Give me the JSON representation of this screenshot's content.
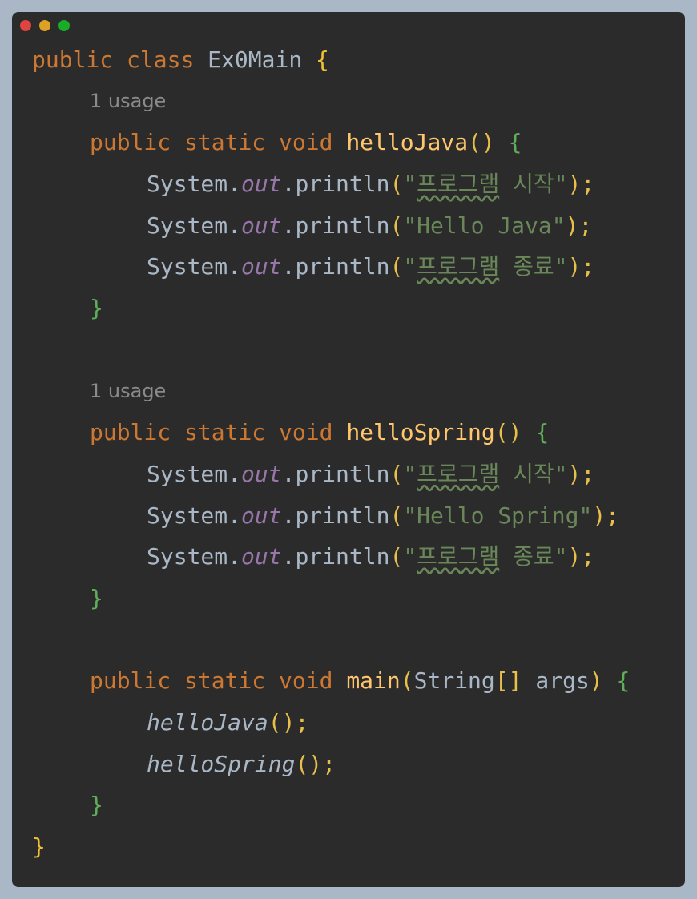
{
  "window_controls": [
    {
      "name": "close",
      "color": "#e0443e"
    },
    {
      "name": "minimize",
      "color": "#dea123"
    },
    {
      "name": "maximize",
      "color": "#1aab29"
    }
  ],
  "code": {
    "class_decl": {
      "kw1": "public",
      "kw2": "class",
      "name": "Ex0Main",
      "brace": "{"
    },
    "method1": {
      "usage": "1 usage",
      "kw1": "public",
      "kw2": "static",
      "kw3": "void",
      "name": "helloJava",
      "parens": "()",
      "brace": "{",
      "lines": [
        {
          "prefix": "System.",
          "field": "out",
          "call": ".println",
          "open": "(",
          "q1": "\"",
          "s_wavy": "프로그램",
          "s_rest": " 시작",
          "q2": "\"",
          "close": ");"
        },
        {
          "prefix": "System.",
          "field": "out",
          "call": ".println",
          "open": "(",
          "q1": "\"",
          "s_wavy": "",
          "s_rest": "Hello Java",
          "q2": "\"",
          "close": ");"
        },
        {
          "prefix": "System.",
          "field": "out",
          "call": ".println",
          "open": "(",
          "q1": "\"",
          "s_wavy": "프로그램",
          "s_rest": " 종료",
          "q2": "\"",
          "close": ");"
        }
      ],
      "end": "}"
    },
    "method2": {
      "usage": "1 usage",
      "kw1": "public",
      "kw2": "static",
      "kw3": "void",
      "name": "helloSpring",
      "parens": "()",
      "brace": "{",
      "lines": [
        {
          "prefix": "System.",
          "field": "out",
          "call": ".println",
          "open": "(",
          "q1": "\"",
          "s_wavy": "프로그램",
          "s_rest": " 시작",
          "q2": "\"",
          "close": ");"
        },
        {
          "prefix": "System.",
          "field": "out",
          "call": ".println",
          "open": "(",
          "q1": "\"",
          "s_wavy": "",
          "s_rest": "Hello Spring",
          "q2": "\"",
          "close": ");"
        },
        {
          "prefix": "System.",
          "field": "out",
          "call": ".println",
          "open": "(",
          "q1": "\"",
          "s_wavy": "프로그램",
          "s_rest": " 종료",
          "q2": "\"",
          "close": ");"
        }
      ],
      "end": "}"
    },
    "main": {
      "kw1": "public",
      "kw2": "static",
      "kw3": "void",
      "name": "main",
      "open": "(",
      "type": "String",
      "brackets": "[]",
      "arg": " args",
      "close": ")",
      "brace": "{",
      "calls": [
        {
          "name": "helloJava",
          "parens": "()",
          "semi": ";"
        },
        {
          "name": "helloSpring",
          "parens": "()",
          "semi": ";"
        }
      ],
      "end": "}"
    },
    "class_end": "}"
  }
}
